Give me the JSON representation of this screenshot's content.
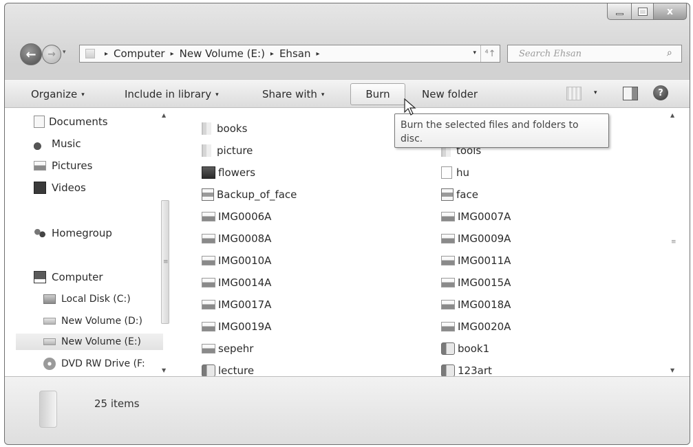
{
  "window": {
    "caption_buttons": [
      "minimize",
      "maximize",
      "close"
    ],
    "close_glyph": "x"
  },
  "nav": {
    "back_glyph": "←",
    "forward_glyph": "→",
    "history_glyph": "▾"
  },
  "address": {
    "breadcrumbs": [
      "Computer",
      "New Volume (E:)",
      "Ehsan"
    ],
    "separator": "▸",
    "dropdown_glyph": "▾",
    "refresh_glyph": "⁴↑"
  },
  "search": {
    "placeholder": "Search Ehsan",
    "icon": "search-icon"
  },
  "toolbar": {
    "organize": "Organize",
    "include_in_library": "Include in library",
    "share_with": "Share with",
    "burn": "Burn",
    "new_folder": "New folder",
    "caret": "▾",
    "help_glyph": "?"
  },
  "sidebar": {
    "items": [
      {
        "label": "Documents",
        "icon": "documents-icon"
      },
      {
        "label": "Music",
        "icon": "music-icon"
      },
      {
        "label": "Pictures",
        "icon": "pictures-icon"
      },
      {
        "label": "Videos",
        "icon": "videos-icon"
      },
      {
        "label": "Homegroup",
        "icon": "homegroup-icon"
      },
      {
        "label": "Computer",
        "icon": "computer-icon"
      },
      {
        "label": "Local Disk (C:)",
        "icon": "local-disk-icon"
      },
      {
        "label": "New Volume (D:)",
        "icon": "drive-icon"
      },
      {
        "label": "New Volume (E:)",
        "icon": "drive-icon",
        "selected": true
      },
      {
        "label": "DVD RW Drive (F:",
        "icon": "dvd-drive-icon"
      }
    ]
  },
  "files": {
    "left": [
      {
        "name": "books",
        "icon": "folder-icon"
      },
      {
        "name": "picture",
        "icon": "folder-icon"
      },
      {
        "name": "flowers",
        "icon": "app-icon"
      },
      {
        "name": "Backup_of_face",
        "icon": "document-icon"
      },
      {
        "name": "IMG0006A",
        "icon": "image-icon"
      },
      {
        "name": "IMG0008A",
        "icon": "image-icon"
      },
      {
        "name": "IMG0010A",
        "icon": "image-icon"
      },
      {
        "name": "IMG0014A",
        "icon": "image-icon"
      },
      {
        "name": "IMG0017A",
        "icon": "image-icon"
      },
      {
        "name": "IMG0019A",
        "icon": "image-icon"
      },
      {
        "name": "sepehr",
        "icon": "image-icon"
      },
      {
        "name": "lecture",
        "icon": "word-document-icon"
      }
    ],
    "right": [
      {
        "name": "tools",
        "icon": "folder-icon",
        "partially_hidden": true
      },
      {
        "name": "hu",
        "icon": "blank-file-icon"
      },
      {
        "name": "face",
        "icon": "document-icon"
      },
      {
        "name": "IMG0007A",
        "icon": "image-icon"
      },
      {
        "name": "IMG0009A",
        "icon": "image-icon"
      },
      {
        "name": "IMG0011A",
        "icon": "image-icon"
      },
      {
        "name": "IMG0015A",
        "icon": "image-icon"
      },
      {
        "name": "IMG0018A",
        "icon": "image-icon"
      },
      {
        "name": "IMG0020A",
        "icon": "image-icon"
      },
      {
        "name": "book1",
        "icon": "word-document-icon"
      },
      {
        "name": "123art",
        "icon": "word-document-icon"
      }
    ]
  },
  "tooltip": {
    "text": "Burn the selected files and folders to disc."
  },
  "status": {
    "item_count": "25 items"
  },
  "scroll_glyphs": {
    "up": "▲",
    "down": "▼",
    "grip": "≡"
  }
}
